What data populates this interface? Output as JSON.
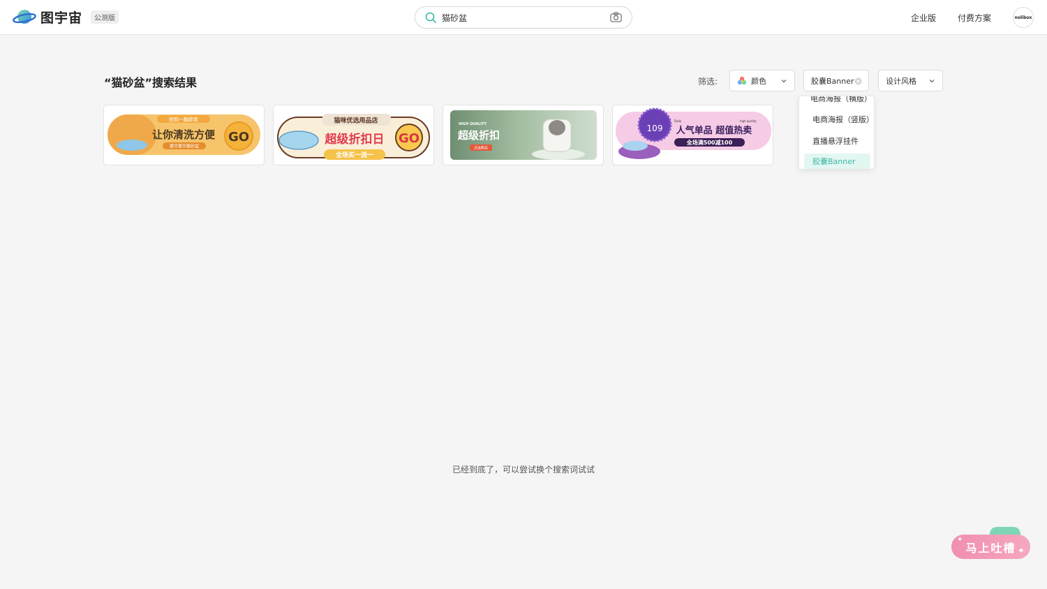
{
  "app": {
    "name": "图宇宙",
    "badge": "公测版"
  },
  "search": {
    "value": "猫砂盆"
  },
  "nav": {
    "enterprise": "企业版",
    "pricing": "付费方案",
    "avatar_text": "nolibox"
  },
  "results": {
    "title": "“猫砂盆”搜索结果",
    "end_text": "已经到底了，可以尝试换个搜索词试试"
  },
  "filter": {
    "label": "筛选:",
    "color": "颜色",
    "type_selected": "胶囊Banner",
    "style": "设计风格",
    "dropdown_options": [
      "电商海报（横版）",
      "电商海报（竖版）",
      "直播悬浮挂件",
      "胶囊Banner"
    ]
  },
  "cards": [
    {
      "tag": "抢购一触即发",
      "headline": "让你清洗方便",
      "sub": "豪华豪华猫砂盆",
      "cta": "GO"
    },
    {
      "tag": "猫咪优选用品店",
      "headline": "超级折扣日",
      "sub": "全场买一送一",
      "cta": "GO"
    },
    {
      "tag": "HIGH QUALITY",
      "headline": "超级折扣",
      "sub": "点击购买"
    },
    {
      "badge": "109",
      "headline": "人气单品  超值热卖",
      "sub": "全场满500减100",
      "tag_left": "Daily",
      "tag_right": "high quality"
    }
  ],
  "feedback": {
    "label": "马上吐槽"
  },
  "colors": {
    "accent": "#3cb8a4",
    "feedback": "#f08fb0"
  }
}
